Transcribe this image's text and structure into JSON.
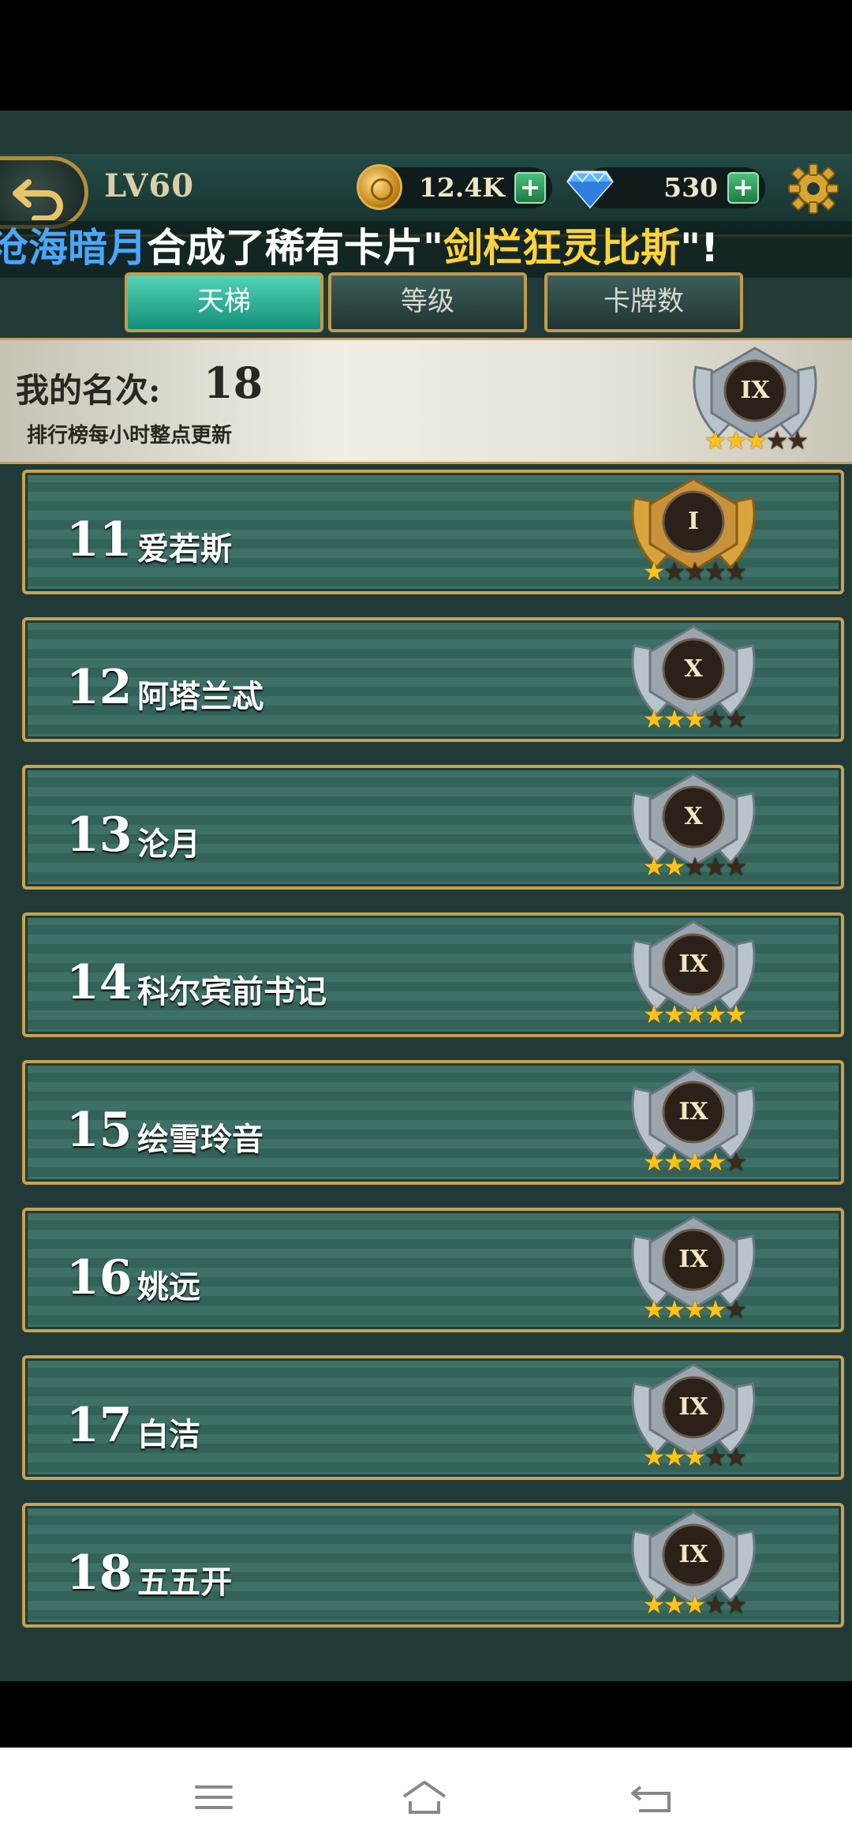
{
  "header": {
    "level": "LV60",
    "gold": "12.4K",
    "gems": "530",
    "back_icon": "back-arrow-icon",
    "gear_icon": "gear-icon"
  },
  "ticker": {
    "name": "沧海暗月",
    "middle": "合成了稀有卡片\"",
    "card": "剑栏狂灵比斯",
    "end": "\"!"
  },
  "tabs": [
    {
      "label": "天梯",
      "active": true
    },
    {
      "label": "等级",
      "active": false
    },
    {
      "label": "卡牌数",
      "active": false
    }
  ],
  "my_rank": {
    "label": "我的名次:",
    "value": "18",
    "note": "排行榜每小时整点更新",
    "badge": {
      "numeral": "IX",
      "stars_on": 3,
      "stars_total": 5
    }
  },
  "rows": [
    {
      "rank": "11",
      "name": "爱若斯",
      "badge": {
        "numeral": "I",
        "tier": "gold",
        "stars_on": 1,
        "stars_total": 5
      }
    },
    {
      "rank": "12",
      "name": "阿塔兰忒",
      "badge": {
        "numeral": "X",
        "tier": "silver",
        "stars_on": 3,
        "stars_total": 5
      }
    },
    {
      "rank": "13",
      "name": "沦月",
      "badge": {
        "numeral": "X",
        "tier": "silver",
        "stars_on": 2,
        "stars_total": 5
      }
    },
    {
      "rank": "14",
      "name": "科尔宾前书记",
      "badge": {
        "numeral": "IX",
        "tier": "silver",
        "stars_on": 5,
        "stars_total": 5
      }
    },
    {
      "rank": "15",
      "name": "绘雪玲音",
      "badge": {
        "numeral": "IX",
        "tier": "silver",
        "stars_on": 4,
        "stars_total": 5
      }
    },
    {
      "rank": "16",
      "name": "姚远",
      "badge": {
        "numeral": "IX",
        "tier": "silver",
        "stars_on": 4,
        "stars_total": 5
      }
    },
    {
      "rank": "17",
      "name": "白洁",
      "badge": {
        "numeral": "IX",
        "tier": "silver",
        "stars_on": 3,
        "stars_total": 5
      }
    },
    {
      "rank": "18",
      "name": "五五开",
      "badge": {
        "numeral": "IX",
        "tier": "silver",
        "stars_on": 3,
        "stars_total": 5
      }
    }
  ],
  "sysnav": {
    "menu_icon": "menu-icon",
    "home_icon": "home-icon",
    "back_icon": "system-back-icon"
  }
}
